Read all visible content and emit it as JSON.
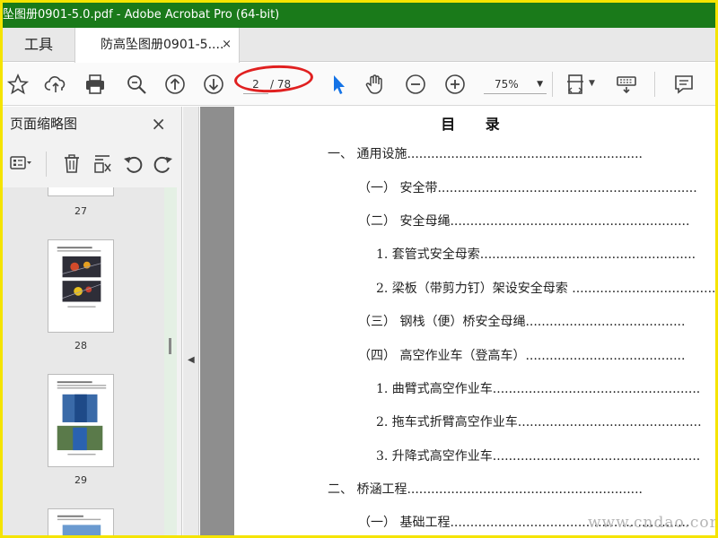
{
  "window": {
    "title": "坠图册0901-5.0.pdf - Adobe Acrobat Pro (64-bit)"
  },
  "tabs": {
    "tools_label": "工具",
    "doc_label": "防高坠图册0901-5....",
    "doc_close": "×"
  },
  "toolbar": {
    "page_current": "2",
    "page_total": "/ 78",
    "zoom_value": "75%"
  },
  "sidebar": {
    "title": "页面缩略图",
    "close": "×",
    "thumbnails": [
      {
        "label": "27"
      },
      {
        "label": "28"
      },
      {
        "label": "29"
      }
    ]
  },
  "toc": {
    "title": "目 录",
    "entries": [
      {
        "text": "一、  通用设施..........................................................."
      },
      {
        "text": "（一）  安全带................................................................."
      },
      {
        "text": "（二）  安全母绳............................................................"
      },
      {
        "text": "1.   套管式安全母索......................................................"
      },
      {
        "text": "2.   梁板（带剪力钉）架设安全母索 ....................................."
      },
      {
        "text": "（三）  钢栈（便）桥安全母绳........................................"
      },
      {
        "text": "（四）  高空作业车（登高车）........................................"
      },
      {
        "text": "1.   曲臂式高空作业车...................................................."
      },
      {
        "text": "2.   拖车式折臂高空作业车.............................................."
      },
      {
        "text": "3.   升降式高空作业车...................................................."
      },
      {
        "text": "二、  桥涵工程..........................................................."
      },
      {
        "text": "（一）  基础工程............................................................"
      }
    ]
  },
  "watermark": "www.cndao.com",
  "colors": {
    "titlebar": "#1a7a1a",
    "frame": "#f5e400",
    "highlight": "#e02020",
    "select_tool": "#1473e6"
  }
}
